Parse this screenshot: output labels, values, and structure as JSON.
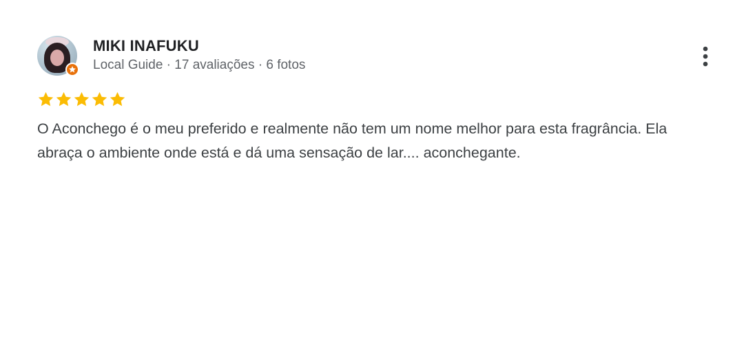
{
  "reviewer": {
    "name": "MIKI INAFUKU",
    "meta": "Local Guide · 17 avaliações · 6 fotos",
    "avatar_icon": "reviewer-avatar",
    "badge_icon": "local-guide-badge-icon",
    "badge_color": "#e8710a"
  },
  "rating": {
    "stars": 5,
    "max": 5,
    "color": "#fbbc04"
  },
  "review": {
    "text": "O Aconchego é o meu preferido e realmente não tem um nome melhor para esta fragrância. Ela abraça o ambiente onde está e dá uma sensação de lar.... aconchegante."
  },
  "menu": {
    "icon": "more-vertical-icon"
  }
}
